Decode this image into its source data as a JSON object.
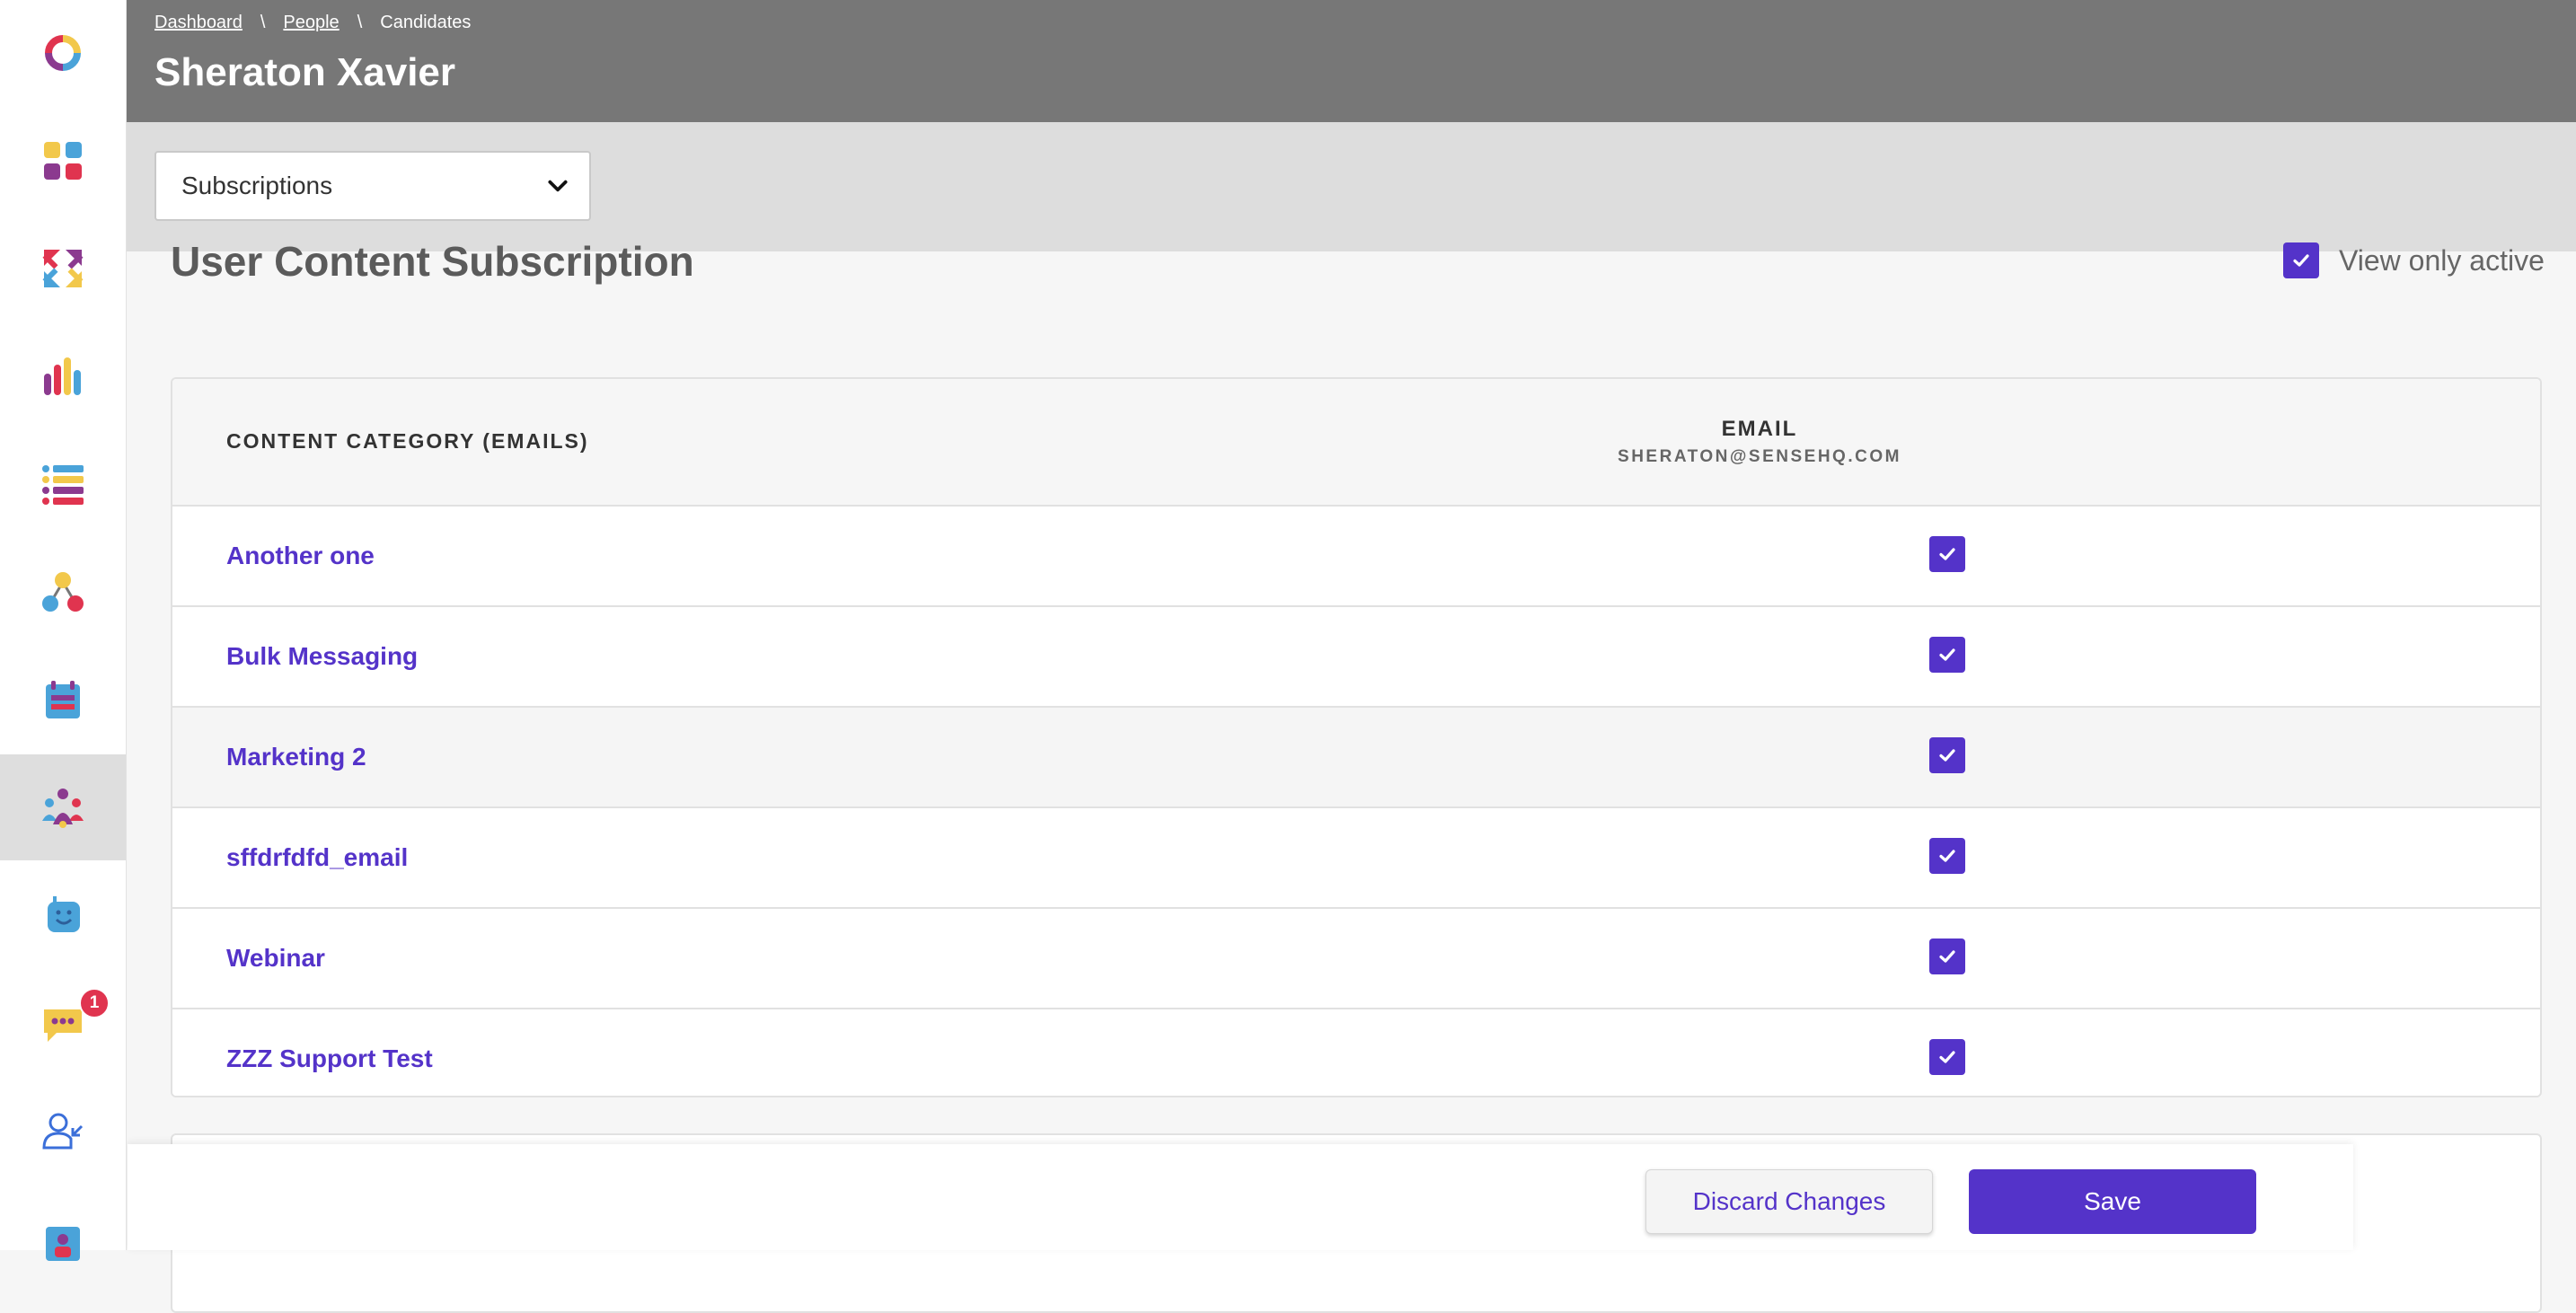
{
  "sidebar": {
    "items": [
      {
        "icon": "logo-ring-icon"
      },
      {
        "icon": "dashboard-grid-icon"
      },
      {
        "icon": "arrows-exchange-icon"
      },
      {
        "icon": "bar-chart-icon"
      },
      {
        "icon": "list-icon"
      },
      {
        "icon": "workflow-icon"
      },
      {
        "icon": "calendar-icon"
      },
      {
        "icon": "people-group-icon",
        "active": true
      },
      {
        "icon": "bot-icon"
      },
      {
        "icon": "chat-bubble-icon",
        "badge": "1"
      },
      {
        "icon": "user-incoming-icon"
      },
      {
        "icon": "app-icon"
      }
    ]
  },
  "header": {
    "breadcrumb": [
      "Dashboard",
      "People",
      "Candidates"
    ],
    "separator": "\\",
    "title": "Sheraton Xavier"
  },
  "toolbar": {
    "select_value": "Subscriptions"
  },
  "section": {
    "title": "User Content Subscription",
    "view_only_active": "View only active"
  },
  "table": {
    "col_category": "CONTENT CATEGORY (EMAILS)",
    "col_email": "EMAIL",
    "col_email_address": "SHERATON@SENSEHQ.COM",
    "rows": [
      {
        "name": "Another one",
        "checked": true
      },
      {
        "name": "Bulk Messaging",
        "checked": true
      },
      {
        "name": "Marketing 2",
        "checked": true
      },
      {
        "name": "sffdrfdfd_email",
        "checked": true
      },
      {
        "name": "Webinar",
        "checked": true
      },
      {
        "name": "ZZZ Support Test",
        "checked": true
      }
    ]
  },
  "actions": {
    "discard_label": "Discard Changes",
    "save_label": "Save"
  },
  "colors": {
    "accent": "#5433c9",
    "header_bg": "#777777",
    "toolbar_bg": "#dddddd",
    "badge": "#e0344f"
  }
}
